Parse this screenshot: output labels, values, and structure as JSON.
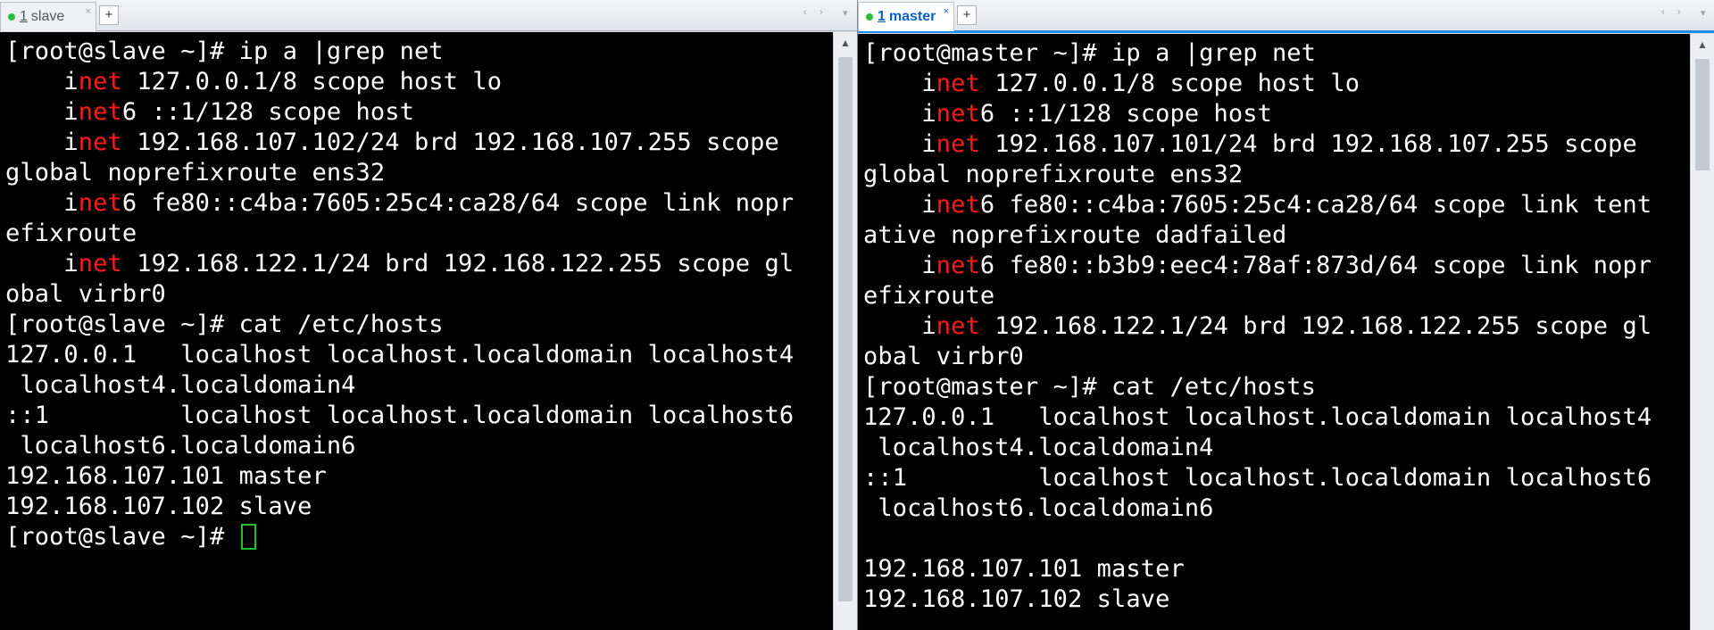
{
  "left": {
    "tab": {
      "number": "1",
      "title": "slave",
      "close": "×"
    },
    "new_tab": "+",
    "nav": {
      "prev": "‹",
      "next": "›",
      "menu": "▾"
    },
    "lines": [
      [
        {
          "t": "[root@slave ~]# ip a |grep net"
        }
      ],
      [
        {
          "t": "    i"
        },
        {
          "t": "net",
          "hl": true
        },
        {
          "t": " 127.0.0.1/8 scope host lo"
        }
      ],
      [
        {
          "t": "    i"
        },
        {
          "t": "net",
          "hl": true
        },
        {
          "t": "6 ::1/128 scope host"
        }
      ],
      [
        {
          "t": "    i"
        },
        {
          "t": "net",
          "hl": true
        },
        {
          "t": " 192.168.107.102/24 brd 192.168.107.255 scope"
        }
      ],
      [
        {
          "t": "global noprefixroute ens32"
        }
      ],
      [
        {
          "t": "    i"
        },
        {
          "t": "net",
          "hl": true
        },
        {
          "t": "6 fe80::c4ba:7605:25c4:ca28/64 scope link nopr"
        }
      ],
      [
        {
          "t": "efixroute"
        }
      ],
      [
        {
          "t": "    i"
        },
        {
          "t": "net",
          "hl": true
        },
        {
          "t": " 192.168.122.1/24 brd 192.168.122.255 scope gl"
        }
      ],
      [
        {
          "t": "obal virbr0"
        }
      ],
      [
        {
          "t": "[root@slave ~]# cat /etc/hosts"
        }
      ],
      [
        {
          "t": "127.0.0.1   localhost localhost.localdomain localhost4"
        }
      ],
      [
        {
          "t": " localhost4.localdomain4"
        }
      ],
      [
        {
          "t": "::1         localhost localhost.localdomain localhost6"
        }
      ],
      [
        {
          "t": " localhost6.localdomain6"
        }
      ],
      [
        {
          "t": "192.168.107.101 master"
        }
      ],
      [
        {
          "t": "192.168.107.102 slave"
        }
      ],
      [
        {
          "t": "[root@slave ~]# "
        },
        {
          "cursor": true
        }
      ]
    ]
  },
  "right": {
    "tab": {
      "number": "1",
      "title": "master",
      "close": "×"
    },
    "new_tab": "+",
    "nav": {
      "prev": "‹",
      "next": "›",
      "menu": "▾"
    },
    "lines": [
      [
        {
          "t": "[root@master ~]# ip a |grep net"
        }
      ],
      [
        {
          "t": "    i"
        },
        {
          "t": "net",
          "hl": true
        },
        {
          "t": " 127.0.0.1/8 scope host lo"
        }
      ],
      [
        {
          "t": "    i"
        },
        {
          "t": "net",
          "hl": true
        },
        {
          "t": "6 ::1/128 scope host"
        }
      ],
      [
        {
          "t": "    i"
        },
        {
          "t": "net",
          "hl": true
        },
        {
          "t": " 192.168.107.101/24 brd 192.168.107.255 scope"
        }
      ],
      [
        {
          "t": "global noprefixroute ens32"
        }
      ],
      [
        {
          "t": "    i"
        },
        {
          "t": "net",
          "hl": true
        },
        {
          "t": "6 fe80::c4ba:7605:25c4:ca28/64 scope link tent"
        }
      ],
      [
        {
          "t": "ative noprefixroute dadfailed"
        }
      ],
      [
        {
          "t": "    i"
        },
        {
          "t": "net",
          "hl": true
        },
        {
          "t": "6 fe80::b3b9:eec4:78af:873d/64 scope link nopr"
        }
      ],
      [
        {
          "t": "efixroute"
        }
      ],
      [
        {
          "t": "    i"
        },
        {
          "t": "net",
          "hl": true
        },
        {
          "t": " 192.168.122.1/24 brd 192.168.122.255 scope gl"
        }
      ],
      [
        {
          "t": "obal virbr0"
        }
      ],
      [
        {
          "t": "[root@master ~]# cat /etc/hosts"
        }
      ],
      [
        {
          "t": "127.0.0.1   localhost localhost.localdomain localhost4"
        }
      ],
      [
        {
          "t": " localhost4.localdomain4"
        }
      ],
      [
        {
          "t": "::1         localhost localhost.localdomain localhost6"
        }
      ],
      [
        {
          "t": " localhost6.localdomain6"
        }
      ],
      [
        {
          "t": ""
        }
      ],
      [
        {
          "t": "192.168.107.101 master"
        }
      ],
      [
        {
          "t": "192.168.107.102 slave"
        }
      ]
    ]
  },
  "scroll": {
    "up": "▲",
    "down": "▼"
  },
  "colors": {
    "highlight": "#ff1a1a",
    "cursor": "#1fbf2f",
    "active_tab": "#0b63c9",
    "tab_status_dot": "#2cbf3c"
  }
}
